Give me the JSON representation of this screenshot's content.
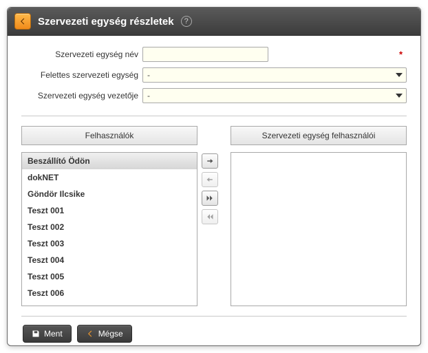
{
  "header": {
    "title": "Szervezeti egység részletek"
  },
  "form": {
    "name_label": "Szervezeti egység név",
    "name_value": "",
    "parent_label": "Felettes szervezeti egység",
    "parent_value": "-",
    "leader_label": "Szervezeti egység vezetője",
    "leader_value": "-"
  },
  "lists": {
    "left_header": "Felhasználók",
    "right_header": "Szervezeti egység felhasználói",
    "left_items": [
      "Beszállító Ödön",
      "dokNET",
      "Göndör Ilcsike",
      "Teszt 001",
      "Teszt 002",
      "Teszt 003",
      "Teszt 004",
      "Teszt 005",
      "Teszt 006"
    ],
    "right_items": []
  },
  "buttons": {
    "save": "Ment",
    "cancel": "Mégse"
  }
}
